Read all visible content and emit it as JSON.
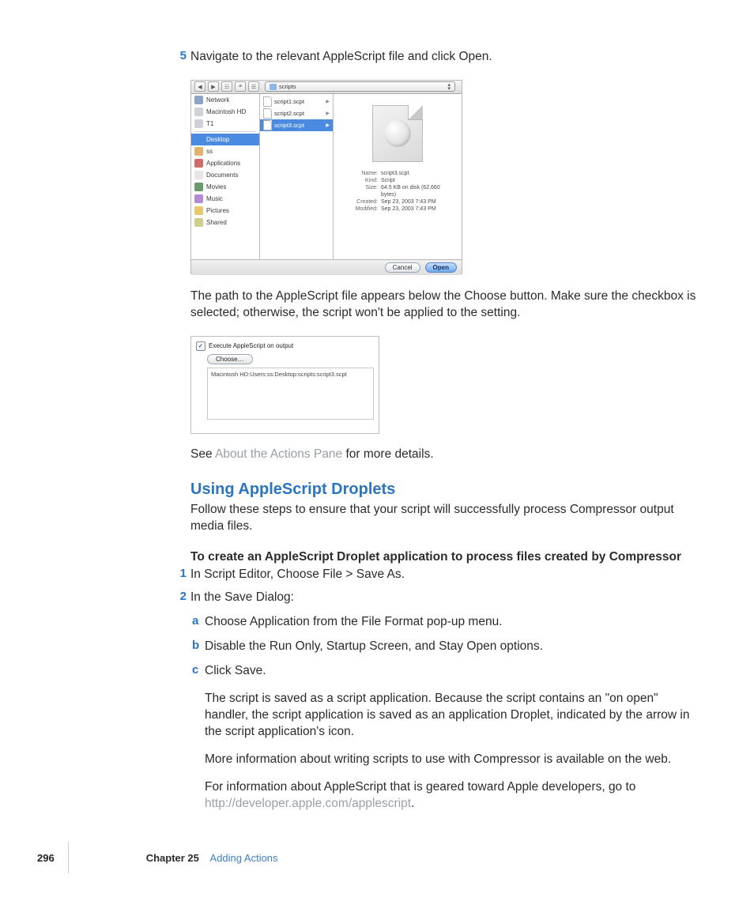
{
  "step5": {
    "num": "5",
    "text": "Navigate to the relevant AppleScript file and click Open."
  },
  "dialog1": {
    "path_popup": "scripts",
    "sidebar": {
      "group1": [
        "Network",
        "Macintosh HD",
        "T1"
      ],
      "group2": [
        "Desktop",
        "ss",
        "Applications",
        "Documents",
        "Movies",
        "Music",
        "Pictures",
        "Shared"
      ]
    },
    "files": [
      "script1.scpt",
      "script2.scpt",
      "script3.scpt"
    ],
    "selected_file": "script3.scpt",
    "meta": {
      "Name": "script3.scpt",
      "Kind": "Script",
      "Size": "64.5 KB on disk (62,660 bytes)",
      "Created": "Sep 23, 2003 7:43 PM",
      "Modified": "Sep 23, 2003 7:43 PM"
    },
    "buttons": {
      "cancel": "Cancel",
      "open": "Open"
    }
  },
  "para_after_dlg1": "The path to the AppleScript file appears below the Choose button. Make sure the checkbox is selected; otherwise, the script won't be applied to the setting.",
  "pane2": {
    "checkbox_label": "Execute AppleScript on output",
    "choose_label": "Choose…",
    "path_text": "Macintosh HD:Users:ss:Desktop:scripts:script3.scpt"
  },
  "see_line": {
    "pre": "See ",
    "link": "About the Actions Pane",
    "post": " for more details."
  },
  "h2": "Using AppleScript Droplets",
  "h2_sub": "Follow these steps to ensure that your script will successfully process Compressor output media files.",
  "bold_line": "To create an AppleScript Droplet application to process files created by Compressor",
  "step1": {
    "num": "1",
    "text": "In Script Editor, Choose File > Save As."
  },
  "step2": {
    "num": "2",
    "text": "In the Save Dialog:",
    "a": {
      "l": "a",
      "t": "Choose Application from the File Format pop-up menu."
    },
    "b": {
      "l": "b",
      "t": "Disable the Run Only, Startup Screen, and Stay Open options."
    },
    "c": {
      "l": "c",
      "t": "Click Save."
    }
  },
  "para_saved": "The script is saved as a script application. Because the script contains an \"on open\" handler, the script application is saved as an application Droplet, indicated by the arrow in the script application's icon.",
  "para_more": "More information about writing scripts to use with Compressor is available on the web.",
  "para_dev_pre": "For information about AppleScript that is geared toward Apple developers, go to ",
  "para_dev_link": "http://developer.apple.com/applescript",
  "para_dev_post": ".",
  "footer": {
    "page": "296",
    "chapter": "Chapter 25",
    "title": "Adding Actions"
  }
}
